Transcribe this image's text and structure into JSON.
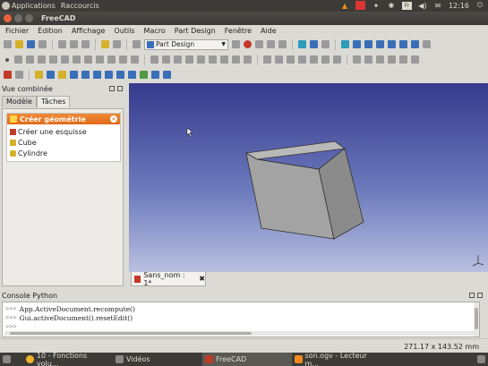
{
  "top_panel": {
    "applications": "Applications",
    "shortcuts": "Raccourcis",
    "clock": "12:16",
    "keyboard_layout": "Fr"
  },
  "window": {
    "title": "FreeCAD"
  },
  "menu": {
    "items": [
      "Fichier",
      "Édition",
      "Affichage",
      "Outils",
      "Macro",
      "Part Design",
      "Fenêtre",
      "Aide"
    ]
  },
  "toolbar": {
    "workbench": "Part Design"
  },
  "combo_view": {
    "title": "Vue combinée",
    "tabs": [
      "Modèle",
      "Tâches"
    ],
    "task_panel": {
      "title": "Créer géométrie",
      "items": [
        "Créer une esquisse",
        "Cube",
        "Cylindre"
      ]
    }
  },
  "document_tab": {
    "label": "Sans_nom : 1*"
  },
  "python_console": {
    "title": "Console Python",
    "lines": [
      {
        "prompt": ">>>",
        "code": "App.ActiveDocument.recompute()"
      },
      {
        "prompt": ">>>",
        "code": "Gui.activeDocument().resetEdit()"
      },
      {
        "prompt": ">>>",
        "code": ""
      }
    ]
  },
  "status_bar": {
    "dimensions": "271.17 x 143.52 mm"
  },
  "taskbar": {
    "tasks": [
      "10 - Fonctions volu...",
      "Vidéos",
      "FreeCAD",
      "son.ogv - Lecteur m..."
    ]
  },
  "colors": {
    "panel_dark": "#3c3b37",
    "task_header": "#e06a18",
    "view_top": "#363a8c",
    "view_bottom": "#b8bfdf"
  }
}
